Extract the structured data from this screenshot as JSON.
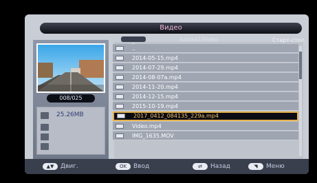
{
  "window": {
    "title": "Видео"
  },
  "preview": {
    "counter": "008/025",
    "file_size": "25.26MB"
  },
  "list": {
    "path": "/udska1/Video",
    "start_label": "Старт-стоп",
    "items": [
      {
        "name": ".."
      },
      {
        "name": "2014-05-15.mp4"
      },
      {
        "name": "2014-07-29.mp4"
      },
      {
        "name": "2014-08-07a.mp4"
      },
      {
        "name": "2014-11-20.mp4"
      },
      {
        "name": "2014-12-15.mp4"
      },
      {
        "name": "2015-10-19.mp4"
      },
      {
        "name": "2017_0412_084135_229a.mp4"
      },
      {
        "name": "Video.mp4"
      },
      {
        "name": "IMG_1635.MOV"
      }
    ],
    "selected_index": 7
  },
  "footer": {
    "move_label": "Двиг.",
    "ok_key": "OK",
    "enter_label": "Ввод",
    "back_label": "Назад",
    "menu_label": "Меню"
  }
}
